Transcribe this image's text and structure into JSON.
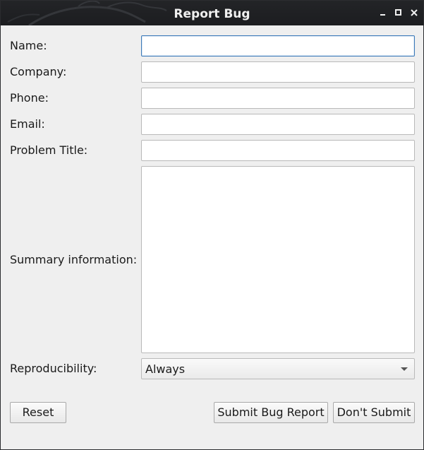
{
  "window": {
    "title": "Report Bug",
    "controls": {
      "minimize": "minimize-icon",
      "maximize": "maximize-icon",
      "close": "close-icon"
    }
  },
  "form": {
    "name": {
      "label": "Name:",
      "value": "",
      "focused": true
    },
    "company": {
      "label": "Company:",
      "value": ""
    },
    "phone": {
      "label": "Phone:",
      "value": ""
    },
    "email": {
      "label": "Email:",
      "value": ""
    },
    "problem_title": {
      "label": "Problem Title:",
      "value": ""
    },
    "summary": {
      "label": "Summary information:",
      "value": ""
    },
    "reproducibility": {
      "label": "Reproducibility:",
      "selected": "Always"
    }
  },
  "buttons": {
    "reset": "Reset",
    "submit": "Submit Bug Report",
    "dont_submit": "Don't Submit"
  },
  "colors": {
    "focus_border": "#3d7ab8",
    "titlebar": "#1f2023",
    "background": "#efefef"
  }
}
